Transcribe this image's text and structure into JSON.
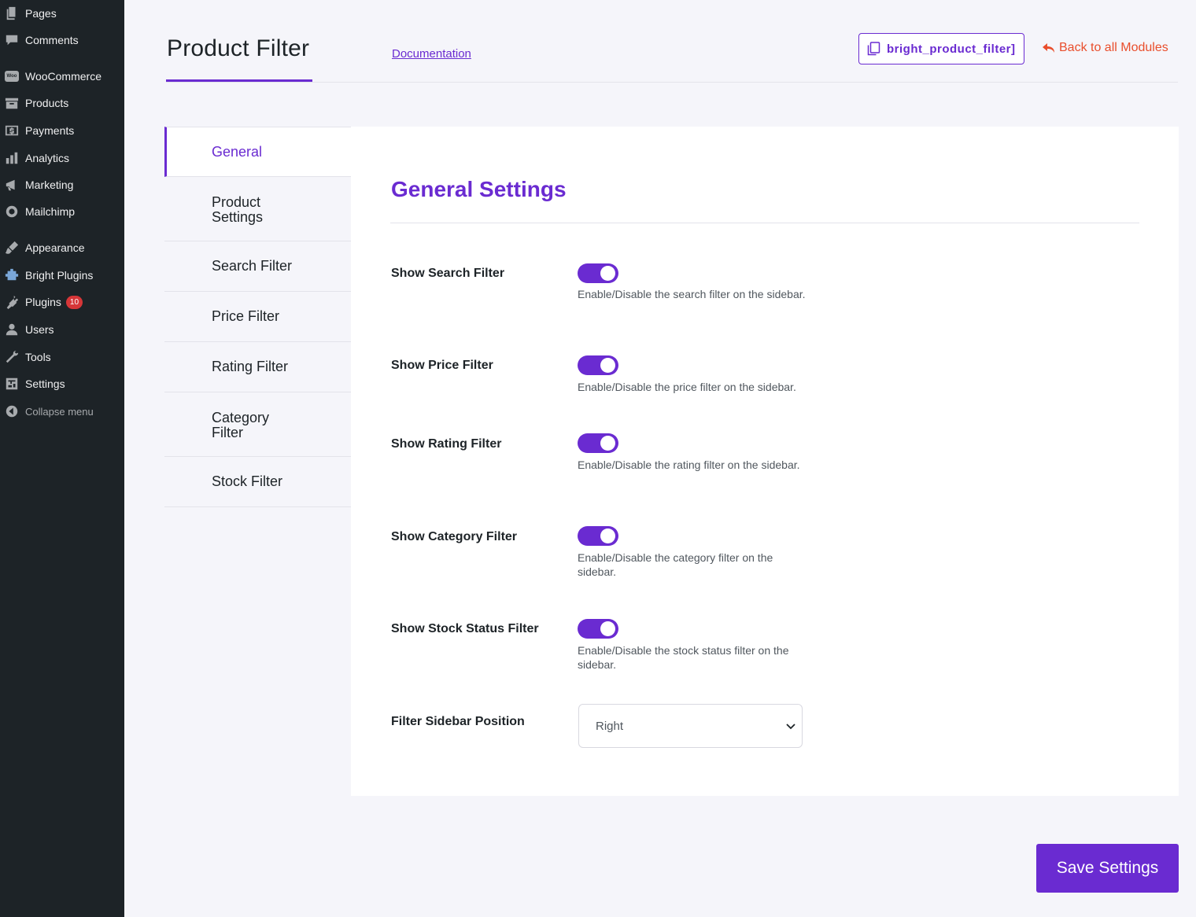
{
  "sidebar": {
    "items": [
      {
        "label": "Pages",
        "icon": "pages-icon"
      },
      {
        "label": "Comments",
        "icon": "comments-icon"
      },
      {
        "label": "WooCommerce",
        "icon": "woocommerce-icon"
      },
      {
        "label": "Products",
        "icon": "products-icon"
      },
      {
        "label": "Payments",
        "icon": "payments-icon"
      },
      {
        "label": "Analytics",
        "icon": "analytics-icon"
      },
      {
        "label": "Marketing",
        "icon": "marketing-icon"
      },
      {
        "label": "Mailchimp",
        "icon": "mailchimp-icon"
      },
      {
        "label": "Appearance",
        "icon": "appearance-icon"
      },
      {
        "label": "Bright Plugins",
        "icon": "bright-plugins-icon"
      },
      {
        "label": "Plugins",
        "icon": "plugins-icon",
        "badge": "10"
      },
      {
        "label": "Users",
        "icon": "users-icon"
      },
      {
        "label": "Tools",
        "icon": "tools-icon"
      },
      {
        "label": "Settings",
        "icon": "settings-icon"
      },
      {
        "label": "Collapse menu",
        "icon": "collapse-icon"
      }
    ],
    "woo_icon_text": "Woo"
  },
  "header": {
    "title": "Product Filter",
    "documentation": "Documentation",
    "shortcode": "bright_product_filter]",
    "back": "Back to all Modules"
  },
  "tabs": [
    {
      "label": "General",
      "active": true
    },
    {
      "label": "Product Settings"
    },
    {
      "label": "Search Filter"
    },
    {
      "label": "Price Filter"
    },
    {
      "label": "Rating Filter"
    },
    {
      "label": "Category Filter"
    },
    {
      "label": "Stock Filter"
    }
  ],
  "panel": {
    "title": "General Settings",
    "settings": [
      {
        "label": "Show Search Filter",
        "enabled": true,
        "desc": "Enable/Disable the search filter on the sidebar."
      },
      {
        "label": "Show Price Filter",
        "enabled": true,
        "desc": "Enable/Disable the price filter on the sidebar."
      },
      {
        "label": "Show Rating Filter",
        "enabled": true,
        "desc": "Enable/Disable the rating filter on the sidebar."
      },
      {
        "label": "Show Category Filter",
        "enabled": true,
        "desc": "Enable/Disable the category filter on the sidebar."
      },
      {
        "label": "Show Stock Status Filter",
        "enabled": true,
        "desc": "Enable/Disable the stock status filter on the sidebar."
      }
    ],
    "position": {
      "label": "Filter Sidebar Position",
      "value": "Right"
    }
  },
  "save_label": "Save Settings",
  "colors": {
    "accent": "#6a2bd1",
    "back_link": "#e94e2c",
    "sidebar_bg": "#1d2327"
  }
}
